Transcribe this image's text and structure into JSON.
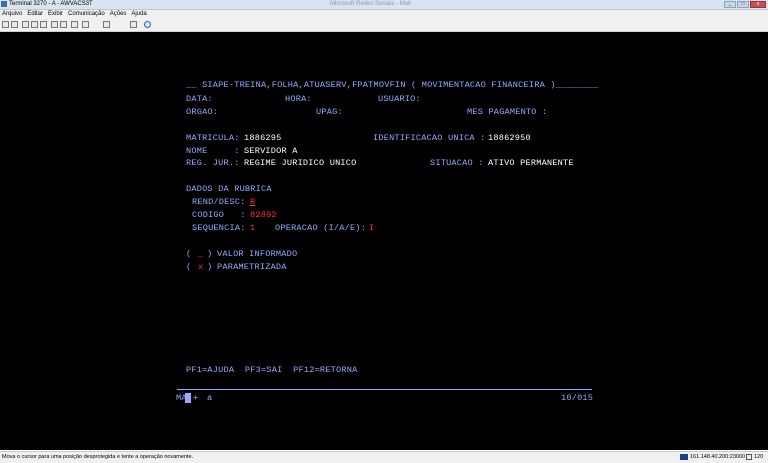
{
  "window": {
    "title": "Terminal 3270 - A - AWVACS3T",
    "center_title": "Microsoft Redes Sociais - Mail",
    "buttons": {
      "minimize": "_",
      "maximize": "□",
      "close": "x"
    }
  },
  "menu": [
    "Arquivo",
    "Editar",
    "Exibir",
    "Comunicação",
    "Ações",
    "Ajuda"
  ],
  "toolbar": [
    "print-icon",
    "copy-icon",
    "paste-icon",
    "send-icon",
    "receive-icon",
    "connect-icon",
    "disconnect-icon",
    "macro-icon",
    "settings-icon",
    "stop-icon",
    "record-icon",
    "help-icon"
  ],
  "terminal": {
    "header": "__ SIAPE-TREINA,FOLHA,ATUASERV,FPATMOVFIN ( MOVIMENTACAO FINANCEIRA )________",
    "data_label": "DATA:",
    "hora_label": "HORA:",
    "usuario_label": "USUARIO:",
    "orgao_label": "ORGAO:",
    "upag_label": "UPAG:",
    "mes_pagamento_label": "MES PAGAMENTO :",
    "matricula_label": "MATRICULA:",
    "matricula_value": "1886295",
    "identificacao_label": "IDENTIFICACAO UNICA :",
    "identificacao_value": "18862950",
    "nome_label": "NOME     :",
    "nome_value": "SERVIDOR A",
    "regjur_label": "REG. JUR.:",
    "regjur_value": "REGIME JURIDICO UNICO",
    "situacao_label": "SITUACAO :",
    "situacao_value": "ATIVO PERMANENTE",
    "dados_rubrica": "DADOS DA RUBRICA",
    "rend_desc_label": "REND/DESC:",
    "rend_desc_value": "R",
    "codigo_label": "CODIGO   :",
    "codigo_value": "82892",
    "sequencia_label": "SEQUENCIA:",
    "sequencia_value": "1",
    "operacao_label": "OPERACAO (I/A/E):",
    "operacao_value": "I",
    "valor_paren_open": "(",
    "valor_mark": "_",
    "valor_paren_close": ")",
    "valor_label": "VALOR INFORMADO",
    "param_paren_open": "(",
    "param_mark": "x",
    "param_paren_close": ")",
    "param_label": "PARAMETRIZADA",
    "pf_keys": "PF1=AJUDA  PF3=SAI  PF12=RETORNA",
    "oia_left": "MA",
    "oia_plus": "+",
    "oia_a": "a",
    "oia_pos": "10/015"
  },
  "status": {
    "message": "Mova o cursor para uma posição desprotegida e tente a operação novamente.",
    "ip": "161.148.40.200:23000",
    "number": "120"
  }
}
